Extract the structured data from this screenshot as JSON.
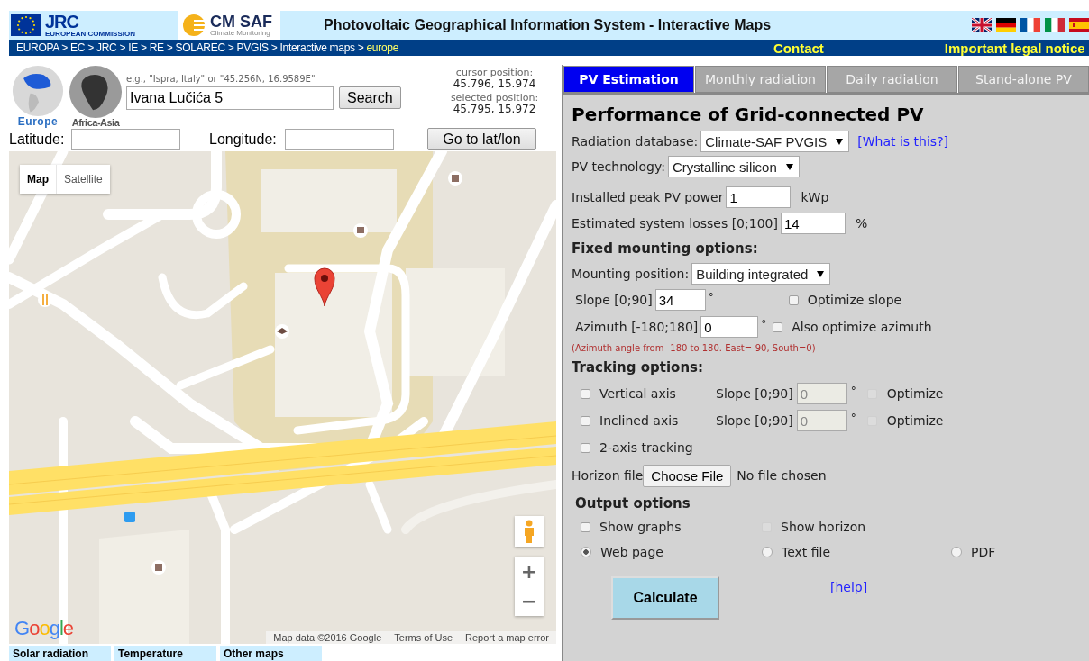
{
  "header": {
    "logos": [
      {
        "kind": "jrc",
        "text": "JRC",
        "subtext": "EUROPEAN COMMISSION"
      },
      {
        "kind": "cmsaf",
        "text": "CM SAF",
        "subtext": "Climate Monitoring"
      }
    ],
    "title": "Photovoltaic Geographical Information System - Interactive Maps",
    "flags": [
      {
        "kind": "uk"
      },
      {
        "kind": "de"
      },
      {
        "kind": "fr"
      },
      {
        "kind": "it"
      },
      {
        "kind": "es"
      }
    ]
  },
  "breadcrumb": {
    "path": "EUROPA > EC > JRC > IE > RE > SOLAREC > PVGIS > Interactive maps >",
    "current": "europe",
    "links": [
      "Contact",
      "Important legal notice"
    ]
  },
  "regions": [
    {
      "label": "Europe",
      "selected": true
    },
    {
      "label": "Africa-Asia",
      "selected": false
    }
  ],
  "search": {
    "hint": "e.g., \"Ispra, Italy\" or \"45.256N, 16.9589E\"",
    "value": "Ivana Lučića 5",
    "button": "Search"
  },
  "positions": [
    {
      "label": "cursor position:",
      "value": "45.796, 15.974"
    },
    {
      "label": "selected position:",
      "value": "45.795, 15.972"
    }
  ],
  "coordinates": {
    "latitude_label": "Latitude:",
    "longitude_label": "Longitude:",
    "button": "Go to lat/lon"
  },
  "map": {
    "types": [
      {
        "label": "Map",
        "selected": true
      },
      {
        "label": "Satellite",
        "selected": false
      }
    ],
    "zoom": [
      "+",
      "−"
    ],
    "logo": "Google",
    "attribution": [
      "Map data ©2016 Google",
      "Terms of Use",
      "Report a map error"
    ]
  },
  "map_tabs": [
    "Solar radiation",
    "Temperature",
    "Other maps"
  ],
  "tabs": [
    {
      "label": "PV Estimation",
      "selected": true
    },
    {
      "label": "Monthly radiation",
      "selected": false
    },
    {
      "label": "Daily radiation",
      "selected": false
    },
    {
      "label": "Stand-alone PV",
      "selected": false
    }
  ],
  "panel_title": "Performance of Grid-connected PV",
  "radiation_database": {
    "label": "Radiation database:",
    "value": "Climate-SAF PVGIS",
    "link": "[What is this?]"
  },
  "pv_technology": {
    "label": "PV technology:",
    "value": "Crystalline silicon"
  },
  "peak_power": {
    "label": "Installed peak PV power",
    "value": "1",
    "unit": "kWp"
  },
  "system_losses": {
    "label": "Estimated system losses [0;100]",
    "value": "14",
    "unit": "%"
  },
  "fixed_mounting": {
    "heading": "Fixed mounting options:",
    "position_label": "Mounting position:",
    "position_value": "Building integrated",
    "angles": [
      {
        "label": "Slope [0;90]",
        "value": "34",
        "unit": "°",
        "optimize_label": "Optimize slope",
        "checked": false
      },
      {
        "label": "Azimuth [-180;180]",
        "value": "0",
        "unit": "°",
        "optimize_label": "Also optimize azimuth",
        "checked": false
      }
    ],
    "note": "(Azimuth angle from -180 to 180. East=-90, South=0)"
  },
  "tracking": {
    "heading": "Tracking options:",
    "rows": [
      {
        "label": "Vertical axis",
        "checked": false,
        "slope_label": "Slope [0;90]",
        "slope_value": "0",
        "unit": "°",
        "optimize_label": "Optimize",
        "optimize_checked": false,
        "disabled": true
      },
      {
        "label": "Inclined axis",
        "checked": false,
        "slope_label": "Slope [0;90]",
        "slope_value": "0",
        "unit": "°",
        "optimize_label": "Optimize",
        "optimize_checked": false,
        "disabled": true
      },
      {
        "label": "2-axis tracking",
        "checked": false
      }
    ]
  },
  "horizon": {
    "label": "Horizon file",
    "button": "Choose File",
    "status": "No file chosen"
  },
  "output": {
    "heading": "Output options",
    "checkboxes": [
      {
        "label": "Show graphs",
        "checked": false,
        "disabled": false
      },
      {
        "label": "Show horizon",
        "checked": false,
        "disabled": true
      }
    ],
    "formats": [
      {
        "label": "Web page",
        "selected": true
      },
      {
        "label": "Text file",
        "selected": false
      },
      {
        "label": "PDF",
        "selected": false
      }
    ]
  },
  "calculate": "Calculate",
  "help": "[help]"
}
